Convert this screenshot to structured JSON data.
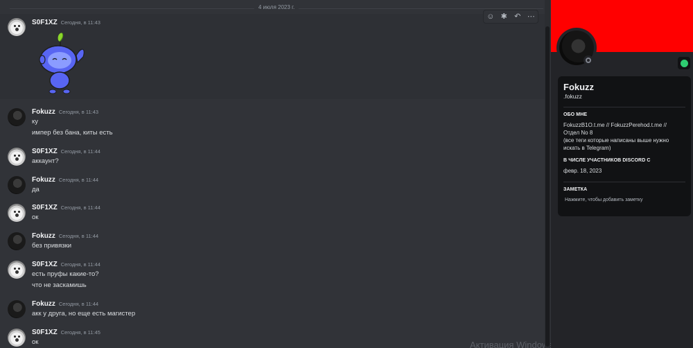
{
  "chat": {
    "date_divider": "4 июля 2023 г.",
    "messages": [
      {
        "author": "S0F1XZ",
        "time": "Сегодня, в 11:43",
        "lines": []
      },
      {
        "author": "Fokuzz",
        "time": "Сегодня, в 11:43",
        "lines": [
          "ку",
          "импер без бана, киты есть"
        ]
      },
      {
        "author": "S0F1XZ",
        "time": "Сегодня, в 11:44",
        "lines": [
          "аккаунт?"
        ]
      },
      {
        "author": "Fokuzz",
        "time": "Сегодня, в 11:44",
        "lines": [
          "да"
        ]
      },
      {
        "author": "S0F1XZ",
        "time": "Сегодня, в 11:44",
        "lines": [
          "ок"
        ]
      },
      {
        "author": "Fokuzz",
        "time": "Сегодня, в 11:44",
        "lines": [
          "без привязки"
        ]
      },
      {
        "author": "S0F1XZ",
        "time": "Сегодня, в 11:44",
        "lines": [
          "есть пруфы какие-то?",
          "что не заскамишь"
        ]
      },
      {
        "author": "Fokuzz",
        "time": "Сегодня, в 11:44",
        "lines": [
          "акк у друга, но еще есть магистер"
        ]
      },
      {
        "author": "S0F1XZ",
        "time": "Сегодня, в 11:45",
        "lines": [
          "ок"
        ]
      }
    ],
    "toolbar_icons": [
      "add-reaction-icon",
      "app-icon",
      "reply-icon",
      "more-icon"
    ],
    "watermark": "Активация Windows"
  },
  "profile": {
    "banner_color": "#ff0000",
    "display_name": "Fokuzz",
    "username": ".fokuzz",
    "about_heading": "ОБО МНЕ",
    "about_text": "FokuzzB1O.t.me // FokuzzPerehod.t.me //\nОтдел  No 8\n(все теги которые написаны выше нужно\nискать в Telegram)",
    "member_since_heading": "В ЧИСЛЕ УЧАСТНИКОВ DISCORD С",
    "member_since": "февр. 18, 2023",
    "note_heading": "ЗАМЕТКА",
    "note_placeholder": "Нажмите, чтобы добавить заметку"
  }
}
